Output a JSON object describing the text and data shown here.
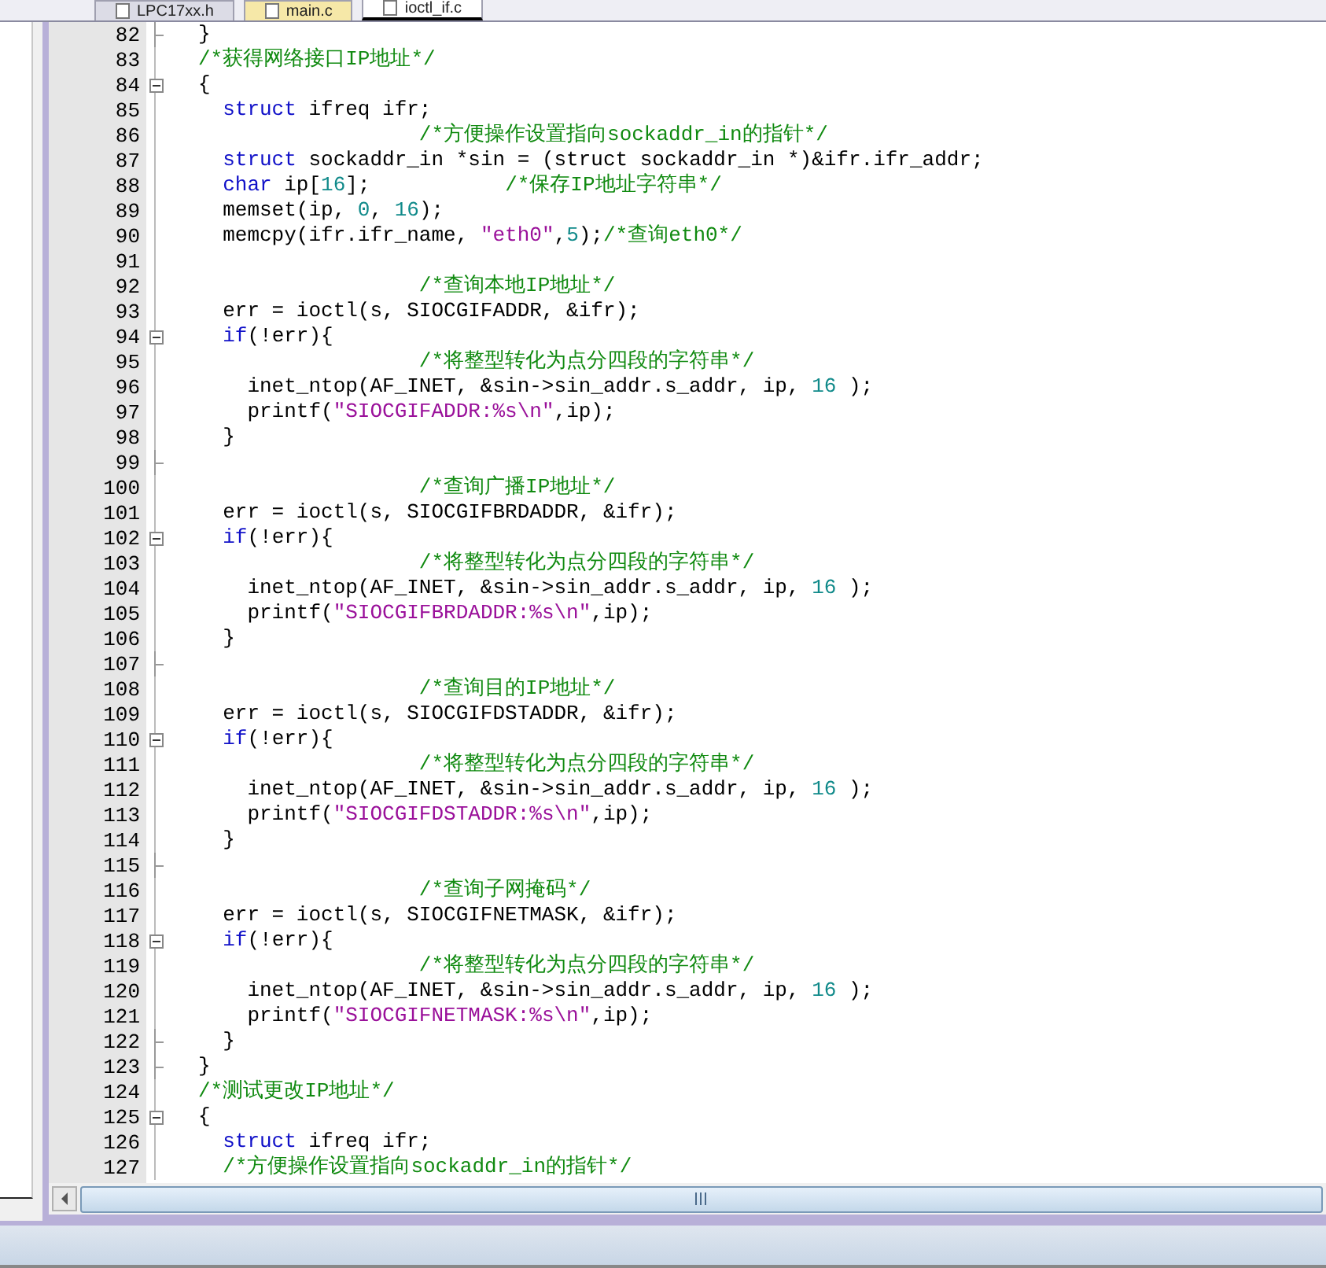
{
  "tabs": [
    {
      "label": "LPC17xx.h",
      "selected": false
    },
    {
      "label": "main.c",
      "selected": false
    },
    {
      "label": "ioctl_if.c",
      "selected": true
    }
  ],
  "lines": [
    {
      "number": "82",
      "fold_toggle": false,
      "fold_end": true,
      "tokens": [
        {
          "t": "}",
          "kind": "text"
        }
      ]
    },
    {
      "number": "83",
      "fold_toggle": false,
      "fold_end": false,
      "tokens": [
        {
          "t": "/*获得网络接口IP地址*/",
          "kind": "comment"
        }
      ]
    },
    {
      "number": "84",
      "fold_toggle": true,
      "fold_end": false,
      "tokens": [
        {
          "t": "{",
          "kind": "text"
        }
      ]
    },
    {
      "number": "85",
      "fold_toggle": false,
      "fold_end": false,
      "tokens": [
        {
          "t": "  struct",
          "kind": "kw"
        },
        {
          "t": " ifreq ifr;",
          "kind": "text"
        }
      ]
    },
    {
      "number": "86",
      "fold_toggle": false,
      "fold_end": false,
      "tokens": [
        {
          "t": "                  /*方便操作设置指向sockaddr_in的指针*/",
          "kind": "comment"
        }
      ]
    },
    {
      "number": "87",
      "fold_toggle": false,
      "fold_end": false,
      "tokens": [
        {
          "t": "  struct",
          "kind": "kw"
        },
        {
          "t": " sockaddr_in *sin = (struct sockaddr_in *)&ifr.ifr_addr;",
          "kind": "text"
        }
      ]
    },
    {
      "number": "88",
      "fold_toggle": false,
      "fold_end": false,
      "tokens": [
        {
          "t": "  char",
          "kind": "kw"
        },
        {
          "t": " ip[",
          "kind": "text"
        },
        {
          "t": "16",
          "kind": "num"
        },
        {
          "t": "];",
          "kind": "text"
        },
        {
          "t": "           /*保存IP地址字符串*/",
          "kind": "comment"
        }
      ]
    },
    {
      "number": "89",
      "fold_toggle": false,
      "fold_end": false,
      "tokens": [
        {
          "t": "  memset(ip, ",
          "kind": "text"
        },
        {
          "t": "0",
          "kind": "num"
        },
        {
          "t": ", ",
          "kind": "text"
        },
        {
          "t": "16",
          "kind": "num"
        },
        {
          "t": ");",
          "kind": "text"
        }
      ]
    },
    {
      "number": "90",
      "fold_toggle": false,
      "fold_end": false,
      "tokens": [
        {
          "t": "  memcpy(ifr.ifr_name, ",
          "kind": "text"
        },
        {
          "t": "\"eth0\"",
          "kind": "string"
        },
        {
          "t": ",",
          "kind": "text"
        },
        {
          "t": "5",
          "kind": "num"
        },
        {
          "t": ");",
          "kind": "text"
        },
        {
          "t": "/*查询eth0*/",
          "kind": "comment"
        }
      ]
    },
    {
      "number": "91",
      "fold_toggle": false,
      "fold_end": false
    },
    {
      "number": "92",
      "fold_toggle": false,
      "fold_end": false,
      "tokens": [
        {
          "t": "                  /*查询本地IP地址*/",
          "kind": "comment"
        }
      ]
    },
    {
      "number": "93",
      "fold_toggle": false,
      "fold_end": false,
      "tokens": [
        {
          "t": "  err = ioctl(s, SIOCGIFADDR, &ifr);",
          "kind": "text"
        }
      ]
    },
    {
      "number": "94",
      "fold_toggle": true,
      "fold_end": false,
      "tokens": [
        {
          "t": "  if",
          "kind": "kw"
        },
        {
          "t": "(!err){",
          "kind": "text"
        }
      ]
    },
    {
      "number": "95",
      "fold_toggle": false,
      "fold_end": false,
      "tokens": [
        {
          "t": "                  /*将整型转化为点分四段的字符串*/",
          "kind": "comment"
        }
      ]
    },
    {
      "number": "96",
      "fold_toggle": false,
      "fold_end": false,
      "tokens": [
        {
          "t": "    inet_ntop(AF_INET, &sin->sin_addr.s_addr, ip, ",
          "kind": "text"
        },
        {
          "t": "16",
          "kind": "num"
        },
        {
          "t": " );",
          "kind": "text"
        }
      ]
    },
    {
      "number": "97",
      "fold_toggle": false,
      "fold_end": false,
      "tokens": [
        {
          "t": "    printf(",
          "kind": "text"
        },
        {
          "t": "\"SIOCGIFADDR:%s\\n\"",
          "kind": "string"
        },
        {
          "t": ",ip);",
          "kind": "text"
        }
      ]
    },
    {
      "number": "98",
      "fold_toggle": false,
      "fold_end": false,
      "tokens": [
        {
          "t": "  }",
          "kind": "text"
        }
      ]
    },
    {
      "number": "99",
      "fold_toggle": false,
      "fold_end": true
    },
    {
      "number": "100",
      "fold_toggle": false,
      "fold_end": false,
      "tokens": [
        {
          "t": "                  /*查询广播IP地址*/",
          "kind": "comment"
        }
      ]
    },
    {
      "number": "101",
      "fold_toggle": false,
      "fold_end": false,
      "tokens": [
        {
          "t": "  err = ioctl(s, SIOCGIFBRDADDR, &ifr);",
          "kind": "text"
        }
      ]
    },
    {
      "number": "102",
      "fold_toggle": true,
      "fold_end": false,
      "tokens": [
        {
          "t": "  if",
          "kind": "kw"
        },
        {
          "t": "(!err){",
          "kind": "text"
        }
      ]
    },
    {
      "number": "103",
      "fold_toggle": false,
      "fold_end": false,
      "tokens": [
        {
          "t": "                  /*将整型转化为点分四段的字符串*/",
          "kind": "comment"
        }
      ]
    },
    {
      "number": "104",
      "fold_toggle": false,
      "fold_end": false,
      "tokens": [
        {
          "t": "    inet_ntop(AF_INET, &sin->sin_addr.s_addr, ip, ",
          "kind": "text"
        },
        {
          "t": "16",
          "kind": "num"
        },
        {
          "t": " );",
          "kind": "text"
        }
      ]
    },
    {
      "number": "105",
      "fold_toggle": false,
      "fold_end": false,
      "tokens": [
        {
          "t": "    printf(",
          "kind": "text"
        },
        {
          "t": "\"SIOCGIFBRDADDR:%s\\n\"",
          "kind": "string"
        },
        {
          "t": ",ip);",
          "kind": "text"
        }
      ]
    },
    {
      "number": "106",
      "fold_toggle": false,
      "fold_end": false,
      "tokens": [
        {
          "t": "  }",
          "kind": "text"
        }
      ]
    },
    {
      "number": "107",
      "fold_toggle": false,
      "fold_end": true
    },
    {
      "number": "108",
      "fold_toggle": false,
      "fold_end": false,
      "tokens": [
        {
          "t": "                  /*查询目的IP地址*/",
          "kind": "comment"
        }
      ]
    },
    {
      "number": "109",
      "fold_toggle": false,
      "fold_end": false,
      "tokens": [
        {
          "t": "  err = ioctl(s, SIOCGIFDSTADDR, &ifr);",
          "kind": "text"
        }
      ]
    },
    {
      "number": "110",
      "fold_toggle": true,
      "fold_end": false,
      "tokens": [
        {
          "t": "  if",
          "kind": "kw"
        },
        {
          "t": "(!err){",
          "kind": "text"
        }
      ]
    },
    {
      "number": "111",
      "fold_toggle": false,
      "fold_end": false,
      "tokens": [
        {
          "t": "                  /*将整型转化为点分四段的字符串*/",
          "kind": "comment"
        }
      ]
    },
    {
      "number": "112",
      "fold_toggle": false,
      "fold_end": false,
      "tokens": [
        {
          "t": "    inet_ntop(AF_INET, &sin->sin_addr.s_addr, ip, ",
          "kind": "text"
        },
        {
          "t": "16",
          "kind": "num"
        },
        {
          "t": " );",
          "kind": "text"
        }
      ]
    },
    {
      "number": "113",
      "fold_toggle": false,
      "fold_end": false,
      "tokens": [
        {
          "t": "    printf(",
          "kind": "text"
        },
        {
          "t": "\"SIOCGIFDSTADDR:%s\\n\"",
          "kind": "string"
        },
        {
          "t": ",ip);",
          "kind": "text"
        }
      ]
    },
    {
      "number": "114",
      "fold_toggle": false,
      "fold_end": false,
      "tokens": [
        {
          "t": "  }",
          "kind": "text"
        }
      ]
    },
    {
      "number": "115",
      "fold_toggle": false,
      "fold_end": true
    },
    {
      "number": "116",
      "fold_toggle": false,
      "fold_end": false,
      "tokens": [
        {
          "t": "                  /*查询子网掩码*/",
          "kind": "comment"
        }
      ]
    },
    {
      "number": "117",
      "fold_toggle": false,
      "fold_end": false,
      "tokens": [
        {
          "t": "  err = ioctl(s, SIOCGIFNETMASK, &ifr);",
          "kind": "text"
        }
      ]
    },
    {
      "number": "118",
      "fold_toggle": true,
      "fold_end": false,
      "tokens": [
        {
          "t": "  if",
          "kind": "kw"
        },
        {
          "t": "(!err){",
          "kind": "text"
        }
      ]
    },
    {
      "number": "119",
      "fold_toggle": false,
      "fold_end": false,
      "tokens": [
        {
          "t": "                  /*将整型转化为点分四段的字符串*/",
          "kind": "comment"
        }
      ]
    },
    {
      "number": "120",
      "fold_toggle": false,
      "fold_end": false,
      "tokens": [
        {
          "t": "    inet_ntop(AF_INET, &sin->sin_addr.s_addr, ip, ",
          "kind": "text"
        },
        {
          "t": "16",
          "kind": "num"
        },
        {
          "t": " );",
          "kind": "text"
        }
      ]
    },
    {
      "number": "121",
      "fold_toggle": false,
      "fold_end": false,
      "tokens": [
        {
          "t": "    printf(",
          "kind": "text"
        },
        {
          "t": "\"SIOCGIFNETMASK:%s\\n\"",
          "kind": "string"
        },
        {
          "t": ",ip);",
          "kind": "text"
        }
      ]
    },
    {
      "number": "122",
      "fold_toggle": false,
      "fold_end": true,
      "tokens": [
        {
          "t": "  }",
          "kind": "text"
        }
      ]
    },
    {
      "number": "123",
      "fold_toggle": false,
      "fold_end": true,
      "tokens": [
        {
          "t": "}",
          "kind": "text"
        }
      ]
    },
    {
      "number": "124",
      "fold_toggle": false,
      "fold_end": false,
      "tokens": [
        {
          "t": "/*测试更改IP地址*/",
          "kind": "comment"
        }
      ]
    },
    {
      "number": "125",
      "fold_toggle": true,
      "fold_end": false,
      "tokens": [
        {
          "t": "{",
          "kind": "text"
        }
      ]
    },
    {
      "number": "126",
      "fold_toggle": false,
      "fold_end": false,
      "tokens": [
        {
          "t": "  struct",
          "kind": "kw"
        },
        {
          "t": " ifreq ifr;",
          "kind": "text"
        }
      ]
    },
    {
      "number": "127",
      "fold_toggle": false,
      "fold_end": false,
      "tokens": [
        {
          "t": "  /*方便操作设置指向sockaddr_in的指针*/",
          "kind": "comment"
        }
      ]
    }
  ]
}
